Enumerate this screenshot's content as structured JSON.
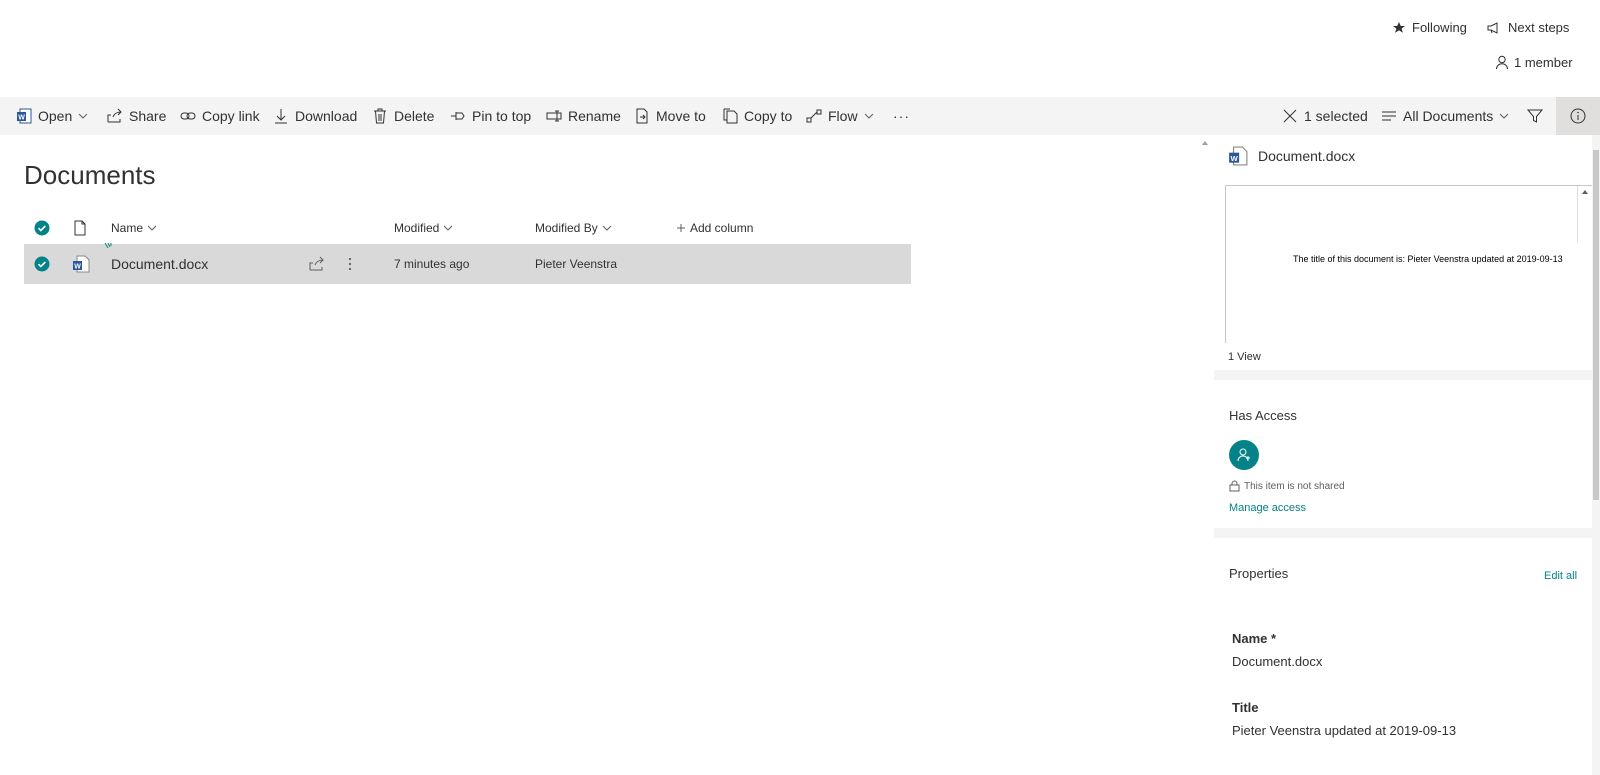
{
  "header": {
    "following_label": "Following",
    "next_steps_label": "Next steps",
    "members_label": "1 member"
  },
  "commandbar": {
    "open": "Open",
    "share": "Share",
    "copy_link": "Copy link",
    "download": "Download",
    "delete": "Delete",
    "pin_to_top": "Pin to top",
    "rename": "Rename",
    "move_to": "Move to",
    "copy_to": "Copy to",
    "flow": "Flow",
    "more": "···",
    "selected": "1 selected",
    "view": "All Documents"
  },
  "library": {
    "title": "Documents",
    "columns": {
      "name": "Name",
      "modified": "Modified",
      "modified_by": "Modified By",
      "add_column": "Add column"
    },
    "rows": [
      {
        "name": "Document.docx",
        "modified": "7 minutes ago",
        "modified_by": "Pieter Veenstra"
      }
    ]
  },
  "details": {
    "file_name": "Document.docx",
    "preview_text": "The title of this document is: Pieter Veenstra updated at 2019-09-13",
    "views": "1 View",
    "has_access_title": "Has Access",
    "not_shared": "This item is not shared",
    "manage_access": "Manage access",
    "properties_title": "Properties",
    "edit_all": "Edit all",
    "name_label": "Name *",
    "name_value": "Document.docx",
    "title_label": "Title",
    "title_value": "Pieter Veenstra updated at 2019-09-13"
  },
  "colors": {
    "accent": "#038387",
    "link": "#0f6fc6",
    "word_blue": "#2b579a"
  }
}
